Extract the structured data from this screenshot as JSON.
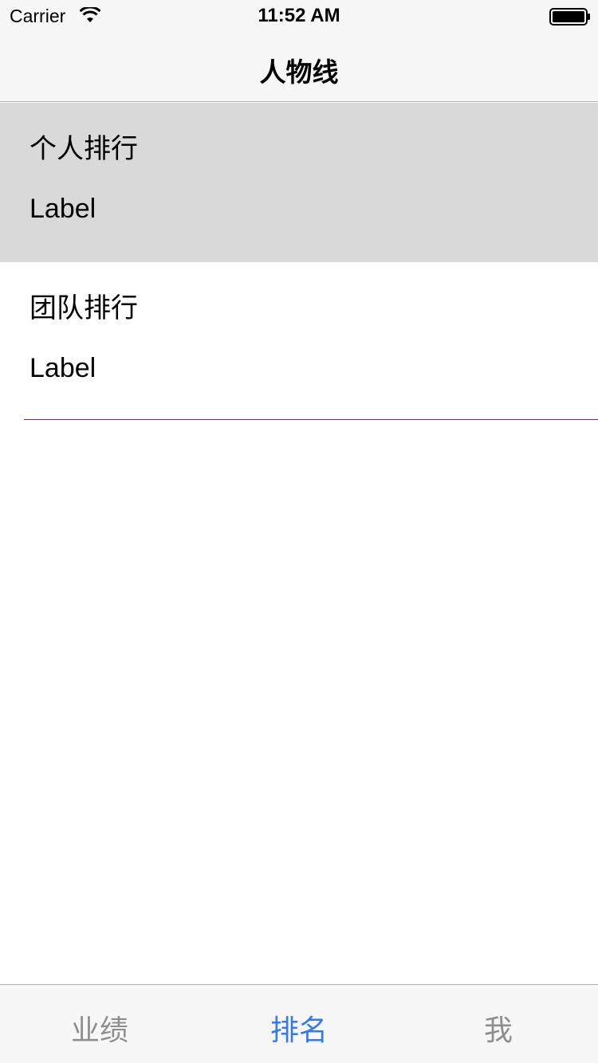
{
  "status_bar": {
    "carrier": "Carrier",
    "time": "11:52 AM",
    "wifi_icon": "wifi-icon",
    "battery_icon": "battery-icon"
  },
  "nav": {
    "title": "人物线"
  },
  "cells": [
    {
      "title": "个人排行",
      "detail": "Label",
      "selected": true
    },
    {
      "title": "团队排行",
      "detail": "Label",
      "selected": false
    }
  ],
  "tabs": [
    {
      "label": "业绩",
      "active": false
    },
    {
      "label": "排名",
      "active": true
    },
    {
      "label": "我",
      "active": false
    }
  ],
  "colors": {
    "active_tab": "#3478f6",
    "inactive_tab": "#8e8e8e",
    "selected_cell": "#d9d9d9",
    "separator": "#8a2a70"
  }
}
